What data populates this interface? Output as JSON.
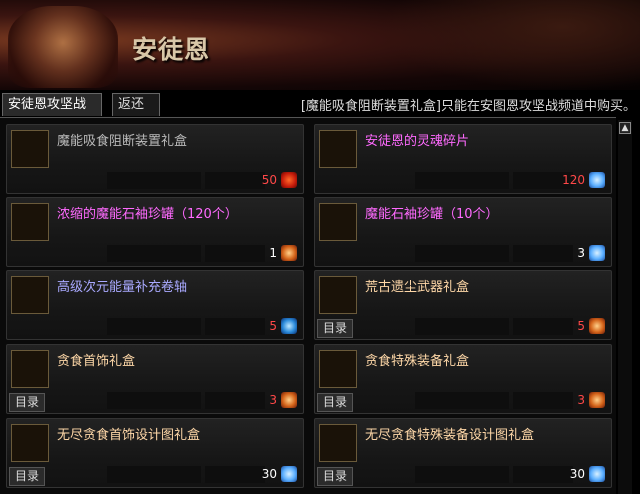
{
  "banner": {
    "title": "安徒恩"
  },
  "tabs": [
    {
      "label": "安徒恩攻坚战"
    },
    {
      "label": "返还"
    }
  ],
  "notice": "[魔能吸食阻断装置礼盒]只能在安图恩攻坚战频道中购买。",
  "scroll": {
    "up_glyph": "▲"
  },
  "catalog_tag": "目录",
  "items": [
    {
      "name": "魔能吸食阻断装置礼盒",
      "price": "50",
      "currency_icon": "red-gem-icon",
      "icon": "cube-icon",
      "name_color": "#bbbbbb",
      "price_color": "#ff4848",
      "has_tag": false
    },
    {
      "name": "安徒恩的灵魂碎片",
      "price": "120",
      "currency_icon": "blue-crystal-icon",
      "icon": "soul-fragment-icon",
      "name_color": "#ff6aff",
      "price_color": "#ff4848",
      "has_tag": false
    },
    {
      "name": "浓缩的魔能石袖珍罐（120个）",
      "price": "1",
      "currency_icon": "coin-icon",
      "icon": "potion-jar-icon",
      "name_color": "#ff6aff",
      "price_color": "#ffffff",
      "has_tag": false
    },
    {
      "name": "魔能石袖珍罐（10个）",
      "price": "3",
      "currency_icon": "blue-crystal-icon",
      "icon": "potion-jar-icon",
      "name_color": "#ff6aff",
      "price_color": "#ffffff",
      "has_tag": false
    },
    {
      "name": "高级次元能量补充卷轴",
      "price": "5",
      "currency_icon": "blue-crystal-icon",
      "icon": "scroll-icon",
      "name_color": "#a9a9ff",
      "price_color": "#ff4848",
      "has_tag": false
    },
    {
      "name": "荒古遗尘武器礼盒",
      "price": "5",
      "currency_icon": "coin-icon",
      "icon": "gift-box-icon",
      "name_color": "#ffd8a8",
      "price_color": "#ff4848",
      "has_tag": true
    },
    {
      "name": "贪食首饰礼盒",
      "price": "3",
      "currency_icon": "coin-icon",
      "icon": "gift-box-icon",
      "name_color": "#ffd8a8",
      "price_color": "#ff4848",
      "has_tag": true
    },
    {
      "name": "贪食特殊装备礼盒",
      "price": "3",
      "currency_icon": "coin-icon",
      "icon": "gift-box-icon",
      "name_color": "#ffd8a8",
      "price_color": "#ff4848",
      "has_tag": true
    },
    {
      "name": "无尽贪食首饰设计图礼盒",
      "price": "30",
      "currency_icon": "blue-crystal-icon",
      "icon": "gift-box-icon",
      "name_color": "#ffd8a8",
      "price_color": "#ffffff",
      "has_tag": true
    },
    {
      "name": "无尽贪食特殊装备设计图礼盒",
      "price": "30",
      "currency_icon": "blue-crystal-icon",
      "icon": "gift-box-icon",
      "name_color": "#ffd8a8",
      "price_color": "#ffffff",
      "has_tag": true
    }
  ]
}
